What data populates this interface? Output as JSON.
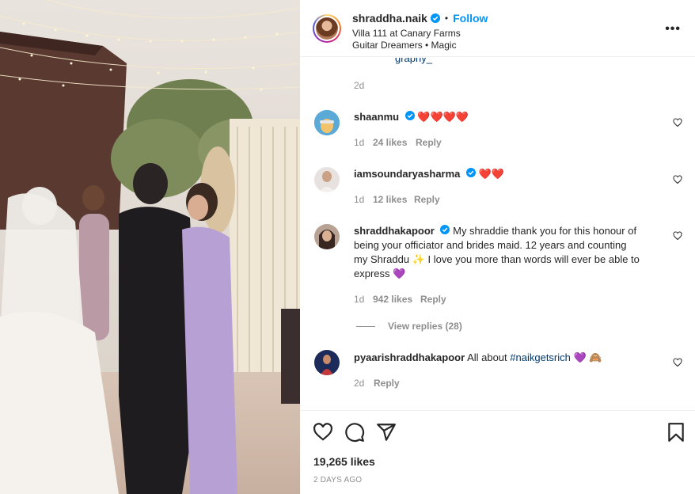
{
  "post": {
    "username": "shraddha.naik",
    "follow_label": "Follow",
    "location": "Villa 111 at Canary Farms",
    "audio": "Guitar Dreamers • Magic",
    "more_label": "•••"
  },
  "partial_comment": {
    "link_fragment": "graphy_",
    "time": "2d"
  },
  "comments": [
    {
      "username": "shaanmu",
      "text": "❤️❤️❤️❤️",
      "time": "1d",
      "likes": "24 likes",
      "reply_label": "Reply"
    },
    {
      "username": "iamsoundaryasharma",
      "text": "❤️❤️",
      "time": "1d",
      "likes": "12 likes",
      "reply_label": "Reply"
    },
    {
      "username": "shraddhakapoor",
      "text_line1": "My shraddie thank you for this honour of",
      "text_line2": "being your officiator and brides maid. 12 years and counting",
      "text_line3_a": "my Shraddu",
      "text_line3_b": "I love you more than words will ever be able to",
      "text_line4": "express",
      "time": "1d",
      "likes": "942 likes",
      "reply_label": "Reply",
      "view_replies": "View replies (28)"
    },
    {
      "username": "pyaarishraddhakapoor",
      "text": "All about",
      "hashtag": "#naikgetsrich",
      "time": "2d",
      "reply_label": "Reply"
    }
  ],
  "footer": {
    "likes": "19,265 likes",
    "posted": "2 DAYS AGO"
  },
  "icons": {
    "verified": "verified-badge-icon",
    "like": "heart-icon",
    "comment": "comment-icon",
    "share": "share-icon",
    "save": "bookmark-icon",
    "more": "more-options-icon"
  },
  "colors": {
    "accent": "#0095f6",
    "link": "#00376b",
    "secondary_text": "#8e8e8e",
    "heart_red": "#ed2e3e",
    "heart_purple": "#8a5cd8"
  }
}
